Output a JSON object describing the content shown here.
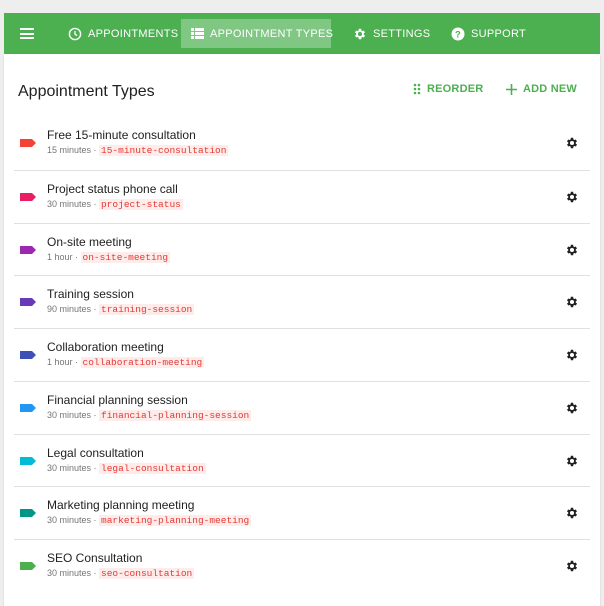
{
  "nav": {
    "tabs": [
      {
        "label": "APPOINTMENTS",
        "icon": "clock-icon"
      },
      {
        "label": "APPOINTMENT TYPES",
        "icon": "list-icon",
        "active": true
      },
      {
        "label": "SETTINGS",
        "icon": "gear-icon"
      },
      {
        "label": "SUPPORT",
        "icon": "help-icon"
      }
    ]
  },
  "page": {
    "title": "Appointment Types",
    "reorder_label": "REORDER",
    "add_label": "ADD NEW"
  },
  "colors": {
    "accent": "#4caf50",
    "nav_active": "#81c784",
    "slug_text": "#e53935"
  },
  "items": [
    {
      "name": "Free 15-minute consultation",
      "duration": "15 minutes",
      "slug": "15-minute-consultation",
      "color": "#f44336"
    },
    {
      "name": "Project status phone call",
      "duration": "30 minutes",
      "slug": "project-status",
      "color": "#e91e63"
    },
    {
      "name": "On-site meeting",
      "duration": "1 hour",
      "slug": "on-site-meeting",
      "color": "#9c27b0"
    },
    {
      "name": "Training session",
      "duration": "90 minutes",
      "slug": "training-session",
      "color": "#673ab7"
    },
    {
      "name": "Collaboration meeting",
      "duration": "1 hour",
      "slug": "collaboration-meeting",
      "color": "#3f51b5"
    },
    {
      "name": "Financial planning session",
      "duration": "30 minutes",
      "slug": "financial-planning-session",
      "color": "#2196f3"
    },
    {
      "name": "Legal consultation",
      "duration": "30 minutes",
      "slug": "legal-consultation",
      "color": "#00bcd4"
    },
    {
      "name": "Marketing planning meeting",
      "duration": "30 minutes",
      "slug": "marketing-planning-meeting",
      "color": "#009688"
    },
    {
      "name": "SEO Consultation",
      "duration": "30 minutes",
      "slug": "seo-consultation",
      "color": "#4caf50"
    }
  ]
}
